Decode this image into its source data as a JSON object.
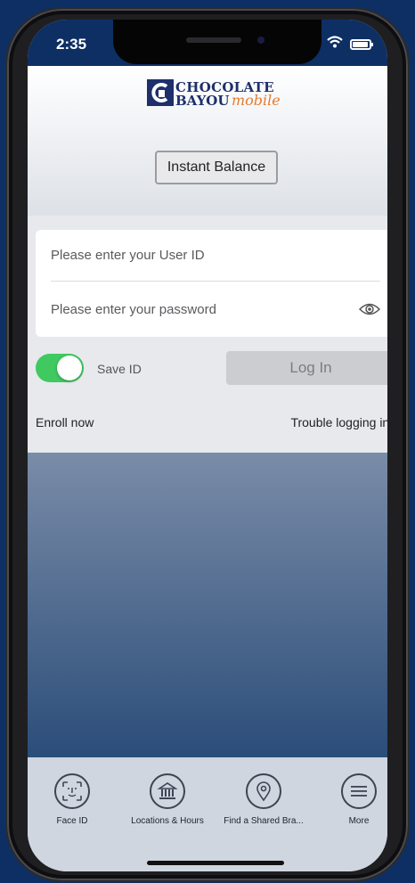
{
  "status": {
    "time": "2:35",
    "signal": "....."
  },
  "brand": {
    "word1": "CHOCOLATE",
    "word2": "BAYOU",
    "word3": "mobile",
    "logo_mark": "CB"
  },
  "header": {
    "instant_balance_label": "Instant Balance"
  },
  "login": {
    "user_id_placeholder": "Please enter your User ID",
    "password_placeholder": "Please enter your password",
    "save_id_label": "Save ID",
    "save_id_enabled": true,
    "login_label": "Log In",
    "enroll_label": "Enroll now",
    "trouble_label": "Trouble logging in?"
  },
  "tabs": [
    {
      "label": "Face ID",
      "icon": "face-id-icon"
    },
    {
      "label": "Locations & Hours",
      "icon": "bank-icon"
    },
    {
      "label": "Find a Shared Bra...",
      "icon": "map-pin-icon"
    },
    {
      "label": "More",
      "icon": "menu-icon"
    }
  ],
  "colors": {
    "brand_navy": "#1e2f6b",
    "brand_orange": "#e67a2e",
    "toggle_on": "#3fc960",
    "background": "#0d2f63"
  }
}
